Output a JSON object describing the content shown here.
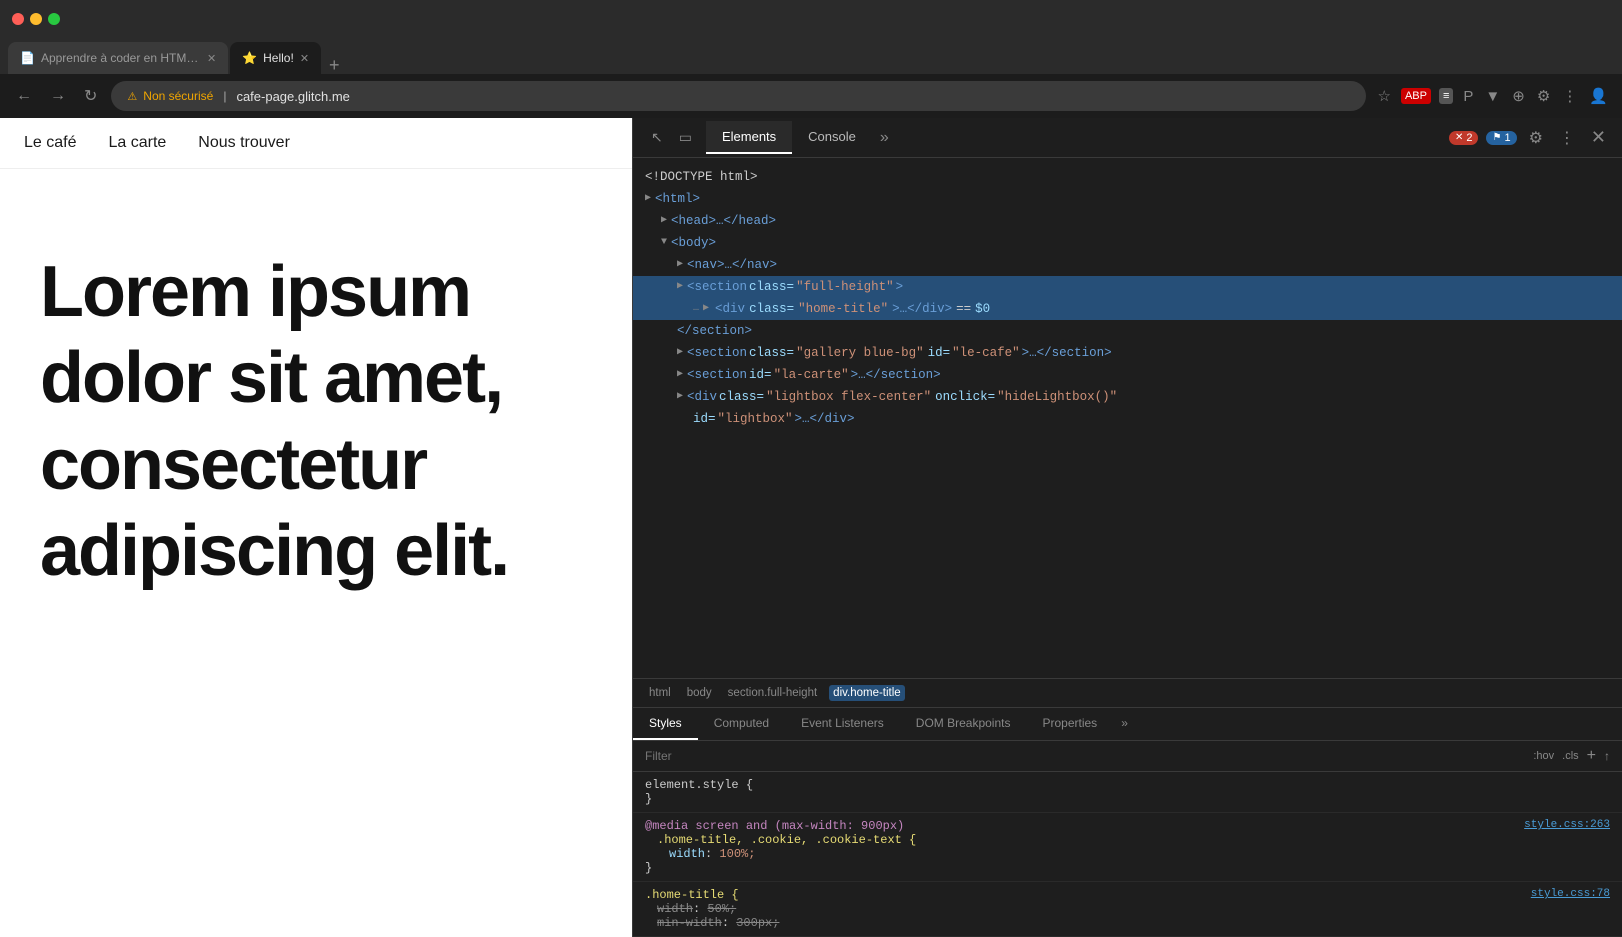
{
  "browser": {
    "traffic_lights": [
      "close",
      "minimize",
      "maximize"
    ],
    "tabs": [
      {
        "id": "tab-1",
        "label": "Apprendre à coder en HTML, C…",
        "favicon": "📄",
        "active": false
      },
      {
        "id": "tab-2",
        "label": "Hello!",
        "favicon": "⭐",
        "active": true
      }
    ],
    "new_tab_label": "+",
    "nav": {
      "back": "←",
      "forward": "→",
      "refresh": "↻"
    },
    "address": {
      "lock_icon": "⚠",
      "lock_label": "Non sécurisé",
      "url": "cafe-page.glitch.me"
    },
    "toolbar_right_icons": [
      "★",
      "ABP",
      "≡",
      "P▾",
      "▼",
      "⊕",
      "⚙",
      "⋮",
      "👤"
    ]
  },
  "website": {
    "nav_items": [
      "Le café",
      "La carte",
      "Nous trouver"
    ],
    "hero_text": "Lorem ipsum dolor sit amet, consectetur adipiscing elit."
  },
  "devtools": {
    "header": {
      "cursor_icon": "↖",
      "device_icon": "▭",
      "tabs": [
        "Elements",
        "Console"
      ],
      "active_tab": "Elements",
      "more_icon": "»",
      "error_count": "2",
      "warning_count": "1",
      "settings_icon": "⚙",
      "dots_icon": "⋮",
      "close_icon": "✕"
    },
    "dom_tree": {
      "lines": [
        {
          "indent": 0,
          "content": "<!DOCTYPE html>",
          "type": "doctype"
        },
        {
          "indent": 0,
          "content": "<html>",
          "type": "tag",
          "triangle": "▶"
        },
        {
          "indent": 1,
          "content": "<head>…</head>",
          "type": "tag",
          "triangle": "▶"
        },
        {
          "indent": 1,
          "content": "<body>",
          "type": "tag",
          "triangle": "▼",
          "open": true
        },
        {
          "indent": 2,
          "content": "<nav>…</nav>",
          "type": "tag",
          "triangle": "▶"
        },
        {
          "indent": 2,
          "content": "<section class=\"full-height\">",
          "type": "tag",
          "triangle": "▶",
          "selected": true
        },
        {
          "indent": 3,
          "content": "<div class=\"home-title\">…</div> == $0",
          "type": "tag",
          "triangle": "▶",
          "selected": true
        },
        {
          "indent": 2,
          "content": "</section>",
          "type": "tag"
        },
        {
          "indent": 2,
          "content": "<section class=\"gallery blue-bg\" id=\"le-cafe\">…</section>",
          "type": "tag",
          "triangle": "▶"
        },
        {
          "indent": 2,
          "content": "<section id=\"la-carte\">…</section>",
          "type": "tag",
          "triangle": "▶"
        },
        {
          "indent": 2,
          "content": "<div class=\"lightbox flex-center\" onclick=\"hideLightbox()\"",
          "type": "tag",
          "triangle": "▶"
        },
        {
          "indent": 3,
          "content": "id=\"lightbox\">…</div>",
          "type": "tag"
        }
      ]
    },
    "breadcrumb": [
      "html",
      "body",
      "section.full-height",
      "div.home-title"
    ],
    "styles_panel": {
      "tabs": [
        "Styles",
        "Computed",
        "Event Listeners",
        "DOM Breakpoints",
        "Properties"
      ],
      "active_tab": "Styles",
      "more_icon": "»",
      "filter_placeholder": "Filter",
      "filter_pseudo": ":hov",
      "filter_cls": ".cls",
      "filter_plus": "+",
      "filter_arrow": "↑",
      "rules": [
        {
          "selector": "element.style {",
          "selector_type": "element",
          "properties": [],
          "closing": "}",
          "source": ""
        },
        {
          "selector": "@media screen and (max-width: 900px)",
          "at_rule": true,
          "inner_selector": ".home-title, .cookie, .cookie-text {",
          "properties": [
            {
              "name": "width",
              "value": "100%;",
              "strikethrough": false
            }
          ],
          "closing": "}",
          "source": "style.css:263"
        },
        {
          "selector": ".home-title {",
          "properties": [
            {
              "name": "width",
              "value": "50%;",
              "strikethrough": true
            },
            {
              "name": "min-width",
              "value": "300px;",
              "strikethrough": true
            }
          ],
          "closing": "",
          "source": "style.css:78"
        }
      ]
    }
  }
}
